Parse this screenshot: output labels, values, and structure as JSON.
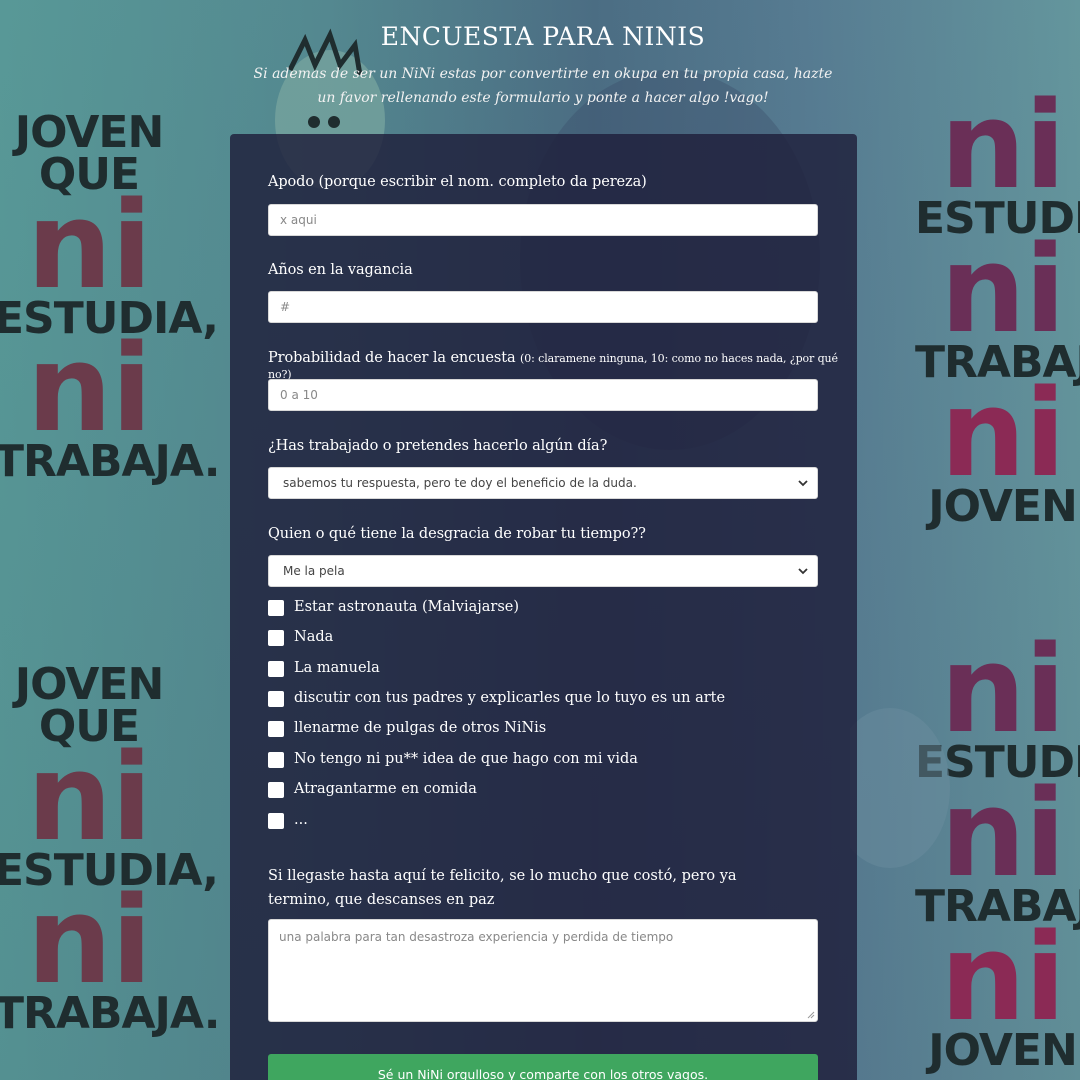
{
  "background": {
    "left_poster": [
      "JOVEN",
      "QUE",
      "ni",
      "ESTUDIA,",
      "ni",
      "TRABAJA."
    ],
    "right_poster": [
      "ni",
      "ESTUDIA",
      "ni",
      "TRABAJA",
      "ni",
      "JOVEN"
    ],
    "colors": {
      "overlay": "#1e1e3a",
      "accent_green": "#3fa65f"
    }
  },
  "header": {
    "title": "ENCUESTA PARA NINIS",
    "subtitle": "Si ademas de ser un NiNi estas por convertirte en okupa en tu propia casa, hazte un favor rellenando este formulario y ponte a hacer algo !vago!"
  },
  "form": {
    "nickname": {
      "label": "Apodo (porque escribir el nom. completo da pereza)",
      "placeholder": "x aqui"
    },
    "years": {
      "label": "Años en la vagancia",
      "placeholder": "#"
    },
    "probability": {
      "label": "Probabilidad de hacer la encuesta",
      "hint": "(0: claramene ninguna, 10: como no haces nada, ¿por qué no?)",
      "placeholder": "0 a 10"
    },
    "worked": {
      "label": "¿Has trabajado o pretendes hacerlo algún día?",
      "selected": "sabemos tu respuesta, pero te doy el beneficio de la duda."
    },
    "time_thief": {
      "label": "Quien o qué tiene la desgracia de robar tu tiempo??",
      "selected": "Me la pela"
    },
    "checkboxes": [
      {
        "label": "Estar astronauta (Malviajarse)"
      },
      {
        "label": "Nada"
      },
      {
        "label": "La manuela"
      },
      {
        "label": "discutir con tus padres y explicarles que lo tuyo es un arte"
      },
      {
        "label": "llenarme de pulgas de otros NiNis"
      },
      {
        "label": "No tengo ni pu** idea de que hago con mi vida"
      },
      {
        "label": "Atragantarme en comida"
      },
      {
        "label": "..."
      }
    ],
    "final": {
      "label": "Si llegaste hasta aquí te felicito, se lo mucho que costó, pero ya termino, que descanses en paz",
      "placeholder": "una palabra para tan desastroza experiencia y perdida de tiempo"
    },
    "submit_label": "Sé un NiNi orgulloso y comparte con los otros vagos."
  }
}
